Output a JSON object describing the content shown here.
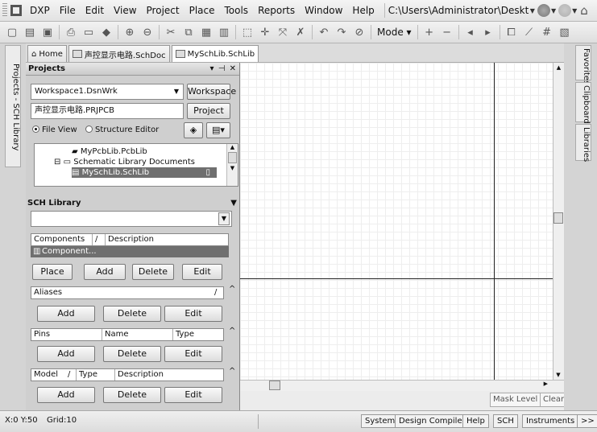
{
  "menubar": {
    "app_menu": "DXP",
    "items": [
      "File",
      "Edit",
      "View",
      "Project",
      "Place",
      "Tools",
      "Reports",
      "Window",
      "Help"
    ],
    "path": "C:\\Users\\Administrator\\Deskto|"
  },
  "toolbar": {
    "mode_label": "Mode"
  },
  "left_dock": {
    "tab_label": "Projects - SCH Library"
  },
  "doc_tabs": [
    {
      "label": "Home"
    },
    {
      "label": "声控显示电路.SchDoc"
    },
    {
      "label": "MySchLib.SchLib"
    }
  ],
  "projects_panel": {
    "title": "Projects",
    "controls": "▾ ⊣ ✕",
    "workspace_value": "Workspace1.DsnWrk",
    "workspace_button": "Workspace",
    "project_value": "声控显示电路.PRJPCB",
    "project_button": "Project",
    "view_options": [
      "File View",
      "Structure Editor"
    ],
    "tree": [
      {
        "label": "MyPcbLib.PcbLib"
      },
      {
        "label": "Schematic Library Documents"
      },
      {
        "label": "MySchLib.SchLib"
      }
    ]
  },
  "sch_library": {
    "title": "SCH Library",
    "filter_value": "",
    "components_headers": [
      "Components",
      "/",
      "Description"
    ],
    "components_rows": [
      "Component..."
    ],
    "component_buttons": [
      "Place",
      "Add",
      "Delete",
      "Edit"
    ],
    "aliases_header": "Aliases",
    "aliases_sort": "/",
    "alias_buttons": [
      "Add",
      "Delete",
      "Edit"
    ],
    "pins_headers": [
      "Pins",
      "Name",
      "Type"
    ],
    "pin_buttons": [
      "Add",
      "Delete",
      "Edit"
    ],
    "model_headers": [
      "Model",
      "/",
      "Type",
      "Description"
    ],
    "model_buttons": [
      "Add",
      "Delete",
      "Edit"
    ]
  },
  "canvas_footer": {
    "mask_level": "Mask Level",
    "clear": "Clear"
  },
  "right_dock": [
    "Favorites",
    "Clipboard",
    "Libraries"
  ],
  "statusbar": {
    "coords": "X:0 Y:50",
    "grid": "Grid:10",
    "buttons": [
      "System",
      "Design Compiler",
      "Help",
      "SCH",
      "Instruments",
      ">>"
    ]
  }
}
